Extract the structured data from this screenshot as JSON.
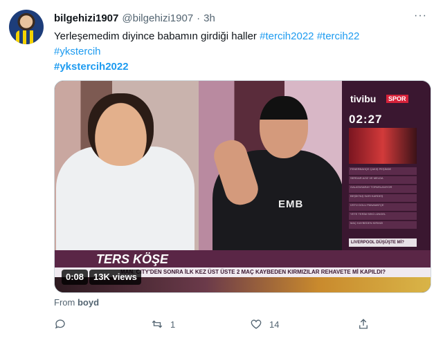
{
  "tweet": {
    "user_name": "bilgehizi1907",
    "user_handle": "@bilgehizi1907",
    "separator": "·",
    "time": "3h",
    "more": "···",
    "text_main": "Yerleşemedim diyince babamın girdiği haller",
    "hashtags_line1": [
      "#tercih2022",
      "#tercih22"
    ],
    "hashtag_line2": "#ykstercih",
    "hashtag_line3": "#ykstercih2022"
  },
  "video": {
    "channel_brand": "tivibu",
    "channel_sub": "SPOR",
    "clock": "02:27",
    "side_list": [
      "FENERBAHÇE ÇAKIŞ PEŞİNDE",
      "SERDAR AZIZ VE MELDA",
      "GALATASARAY TOPARLANIYOR",
      "BEŞİKTAŞ SARI KARDEŞ",
      "ÜSTÜ DOLU PANAMATÇE",
      "YETE TERİM SEKİ LÜNGEL",
      "MAÇ KAYBEDEN KIRMIZI"
    ],
    "side_highlight": "LIVERPOOL DÜŞÜŞTE Mİ?",
    "show_title": "TERS KÖŞE",
    "ticker": "MAN. CITY'DEN SONRA İLK KEZ ÜST ÜSTE 2 MAÇ KAYBEDEN KIRMIZILAR REHAVETE Mİ KAPILDI?",
    "shirt_text": "EMB",
    "time_chip": "0:08",
    "views_chip": "13K views"
  },
  "source": {
    "prefix": "From",
    "name": "boyd"
  },
  "actions": {
    "retweets": "1",
    "likes": "14"
  }
}
